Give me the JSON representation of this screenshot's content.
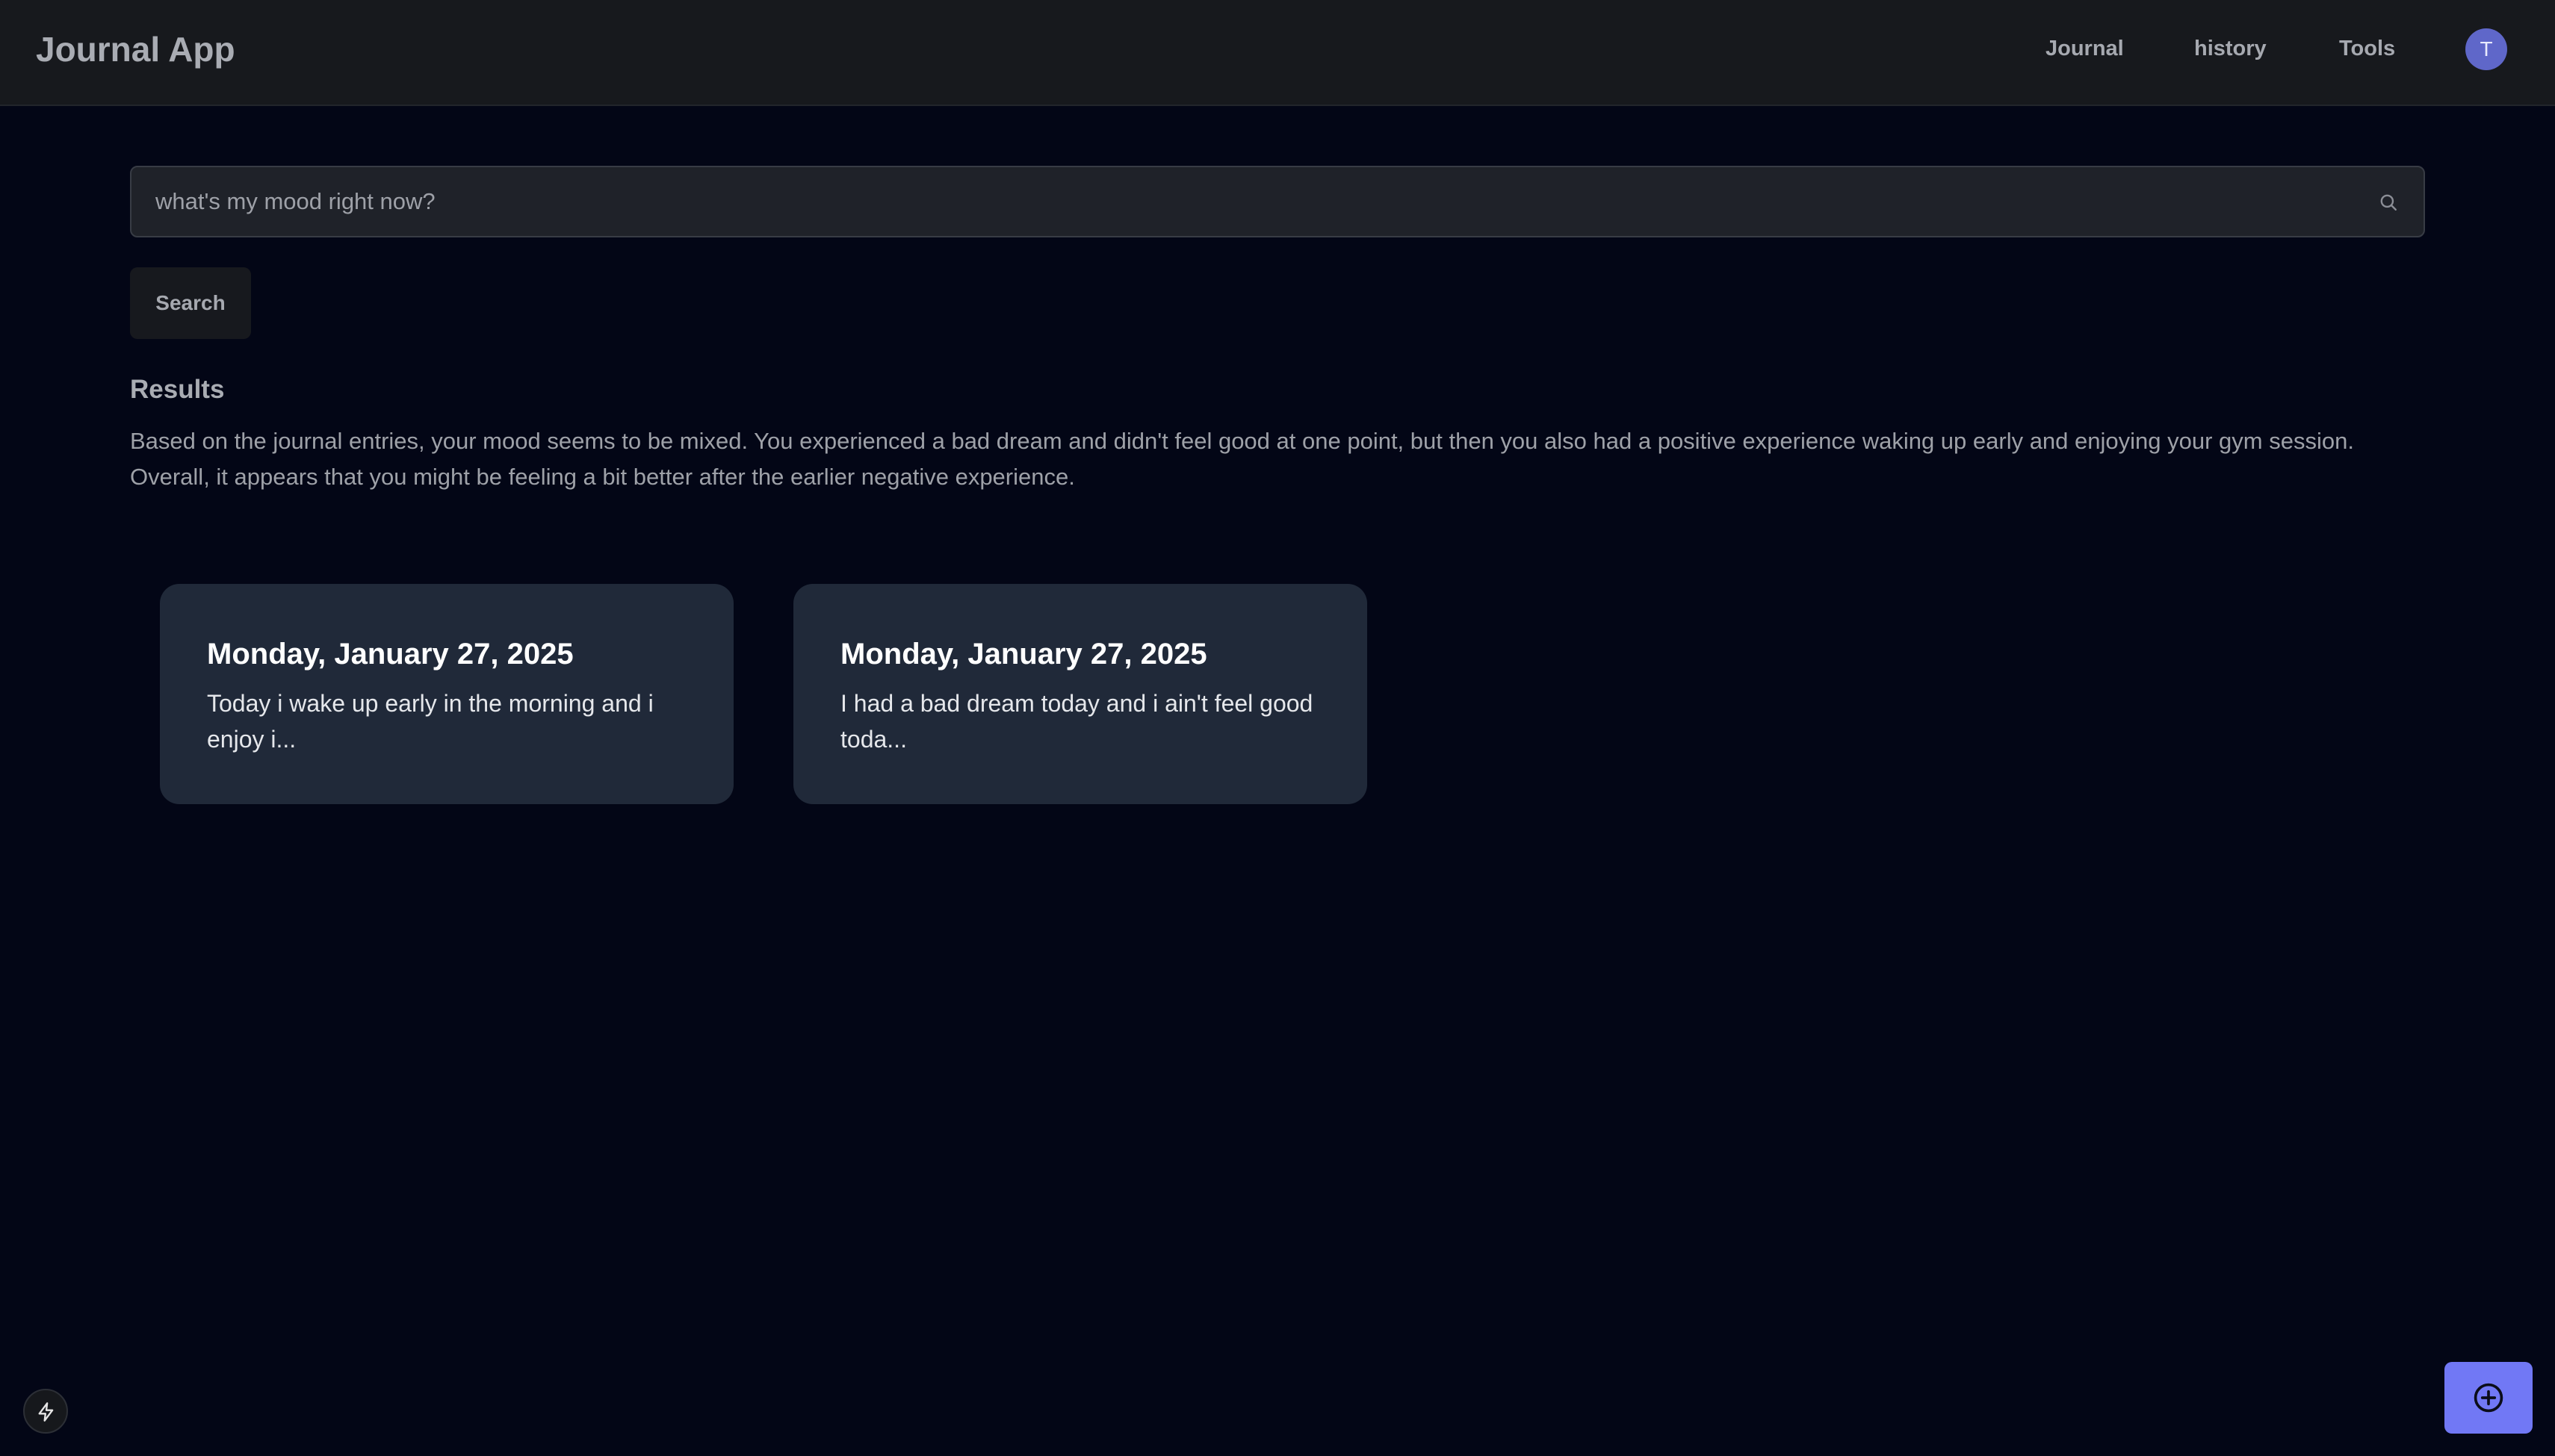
{
  "header": {
    "brand": "Journal App",
    "nav": [
      "Journal",
      "history",
      "Tools"
    ],
    "avatar_initial": "T",
    "avatar_color": "#5f67c9"
  },
  "search": {
    "placeholder": "what's my mood right now?",
    "value": "",
    "icon": "search-icon",
    "button_label": "Search"
  },
  "results": {
    "heading": "Results",
    "summary": "Based on the journal entries, your mood seems to be mixed. You experienced a bad dream and didn't feel good at one point, but then you also had a positive experience waking up early and enjoying your gym session. Overall, it appears that you might be feeling a bit better after the earlier negative experience."
  },
  "entries": [
    {
      "date": "Monday, January 27, 2025",
      "excerpt": "Today i wake up early in the morning and i enjoy i..."
    },
    {
      "date": "Monday, January 27, 2025",
      "excerpt": "I had a bad dream today and i ain't feel good toda..."
    }
  ],
  "floating": {
    "left_icon": "bolt-icon",
    "right_icon": "plus-circle-icon",
    "accent_color": "#7178f5"
  }
}
